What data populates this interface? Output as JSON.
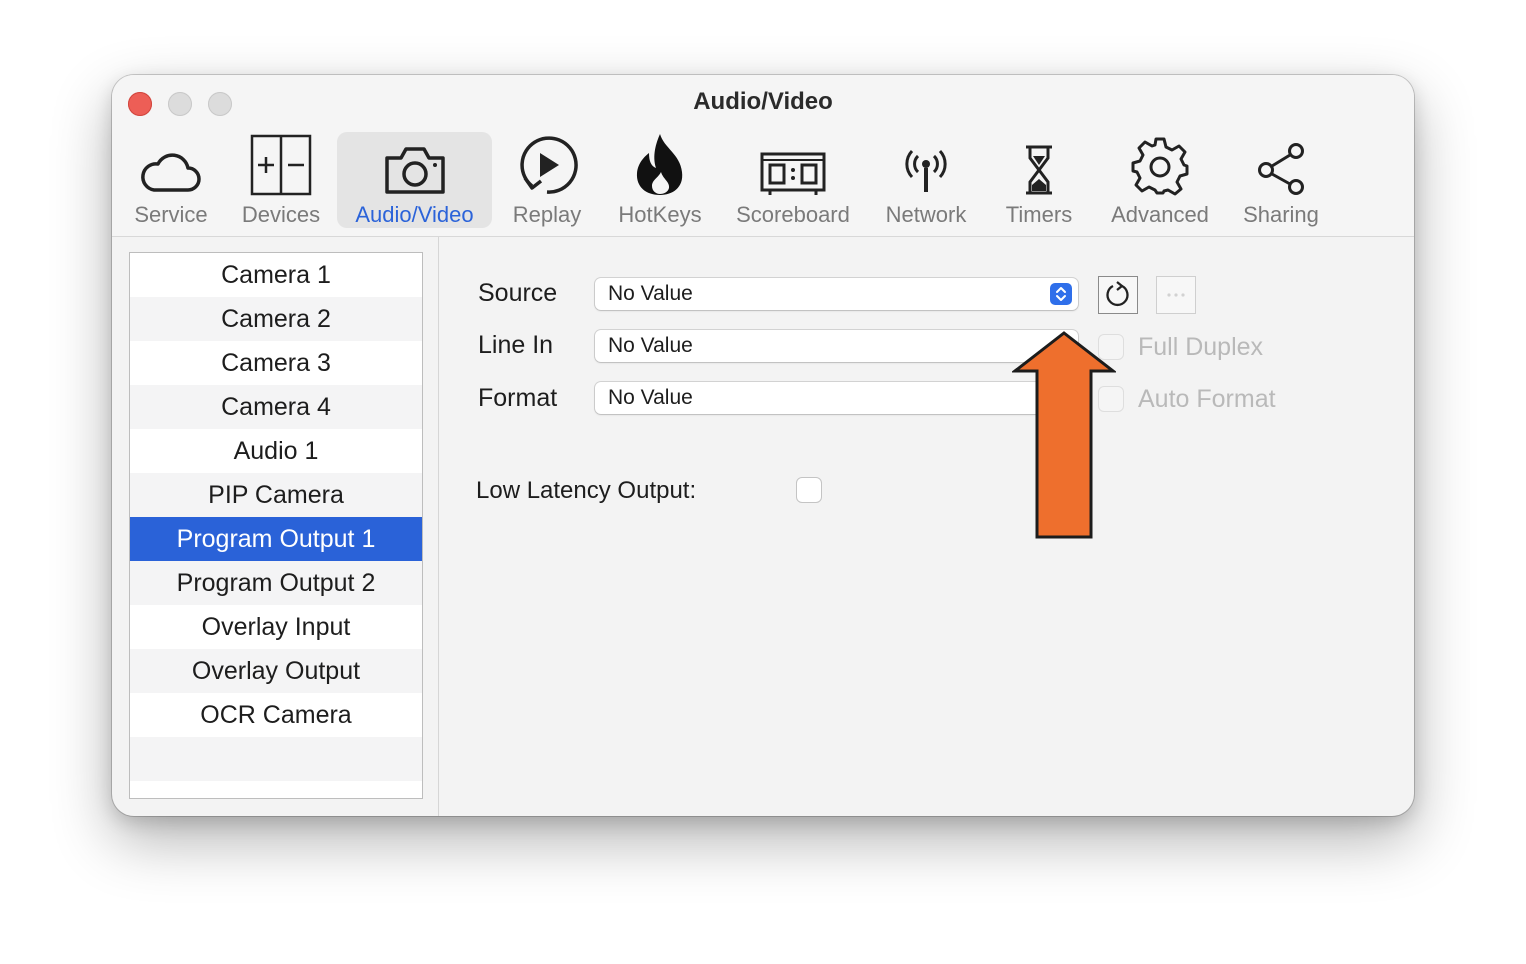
{
  "window": {
    "title": "Audio/Video"
  },
  "toolbar": {
    "items": [
      {
        "label": "Service",
        "icon": "cloud-icon"
      },
      {
        "label": "Devices",
        "icon": "devices-icon"
      },
      {
        "label": "Audio/Video",
        "icon": "camera-icon"
      },
      {
        "label": "Replay",
        "icon": "replay-icon"
      },
      {
        "label": "HotKeys",
        "icon": "flame-icon"
      },
      {
        "label": "Scoreboard",
        "icon": "scoreboard-icon"
      },
      {
        "label": "Network",
        "icon": "antenna-icon"
      },
      {
        "label": "Timers",
        "icon": "hourglass-icon"
      },
      {
        "label": "Advanced",
        "icon": "gear-icon"
      },
      {
        "label": "Sharing",
        "icon": "share-icon"
      }
    ],
    "active": "Audio/Video"
  },
  "sidebar": {
    "items": [
      "Camera 1",
      "Camera 2",
      "Camera 3",
      "Camera 4",
      "Audio 1",
      "PIP Camera",
      "Program Output 1",
      "Program Output 2",
      "Overlay Input",
      "Overlay Output",
      "OCR Camera"
    ],
    "selected": "Program Output 1"
  },
  "form": {
    "source": {
      "label": "Source",
      "value": "No Value"
    },
    "line_in": {
      "label": "Line In",
      "value": "No Value"
    },
    "format": {
      "label": "Format",
      "value": "No Value"
    },
    "full_duplex": {
      "label": "Full Duplex",
      "checked": false
    },
    "auto_format": {
      "label": "Auto Format",
      "checked": false
    },
    "low_latency": {
      "label": "Low Latency Output:",
      "checked": false
    },
    "refresh_icon": "refresh-icon",
    "more_icon": "ellipsis-icon"
  },
  "annotation": {
    "color": "#ee6f2d",
    "icon": "arrow-up-icon"
  },
  "colors": {
    "accent": "#2a62d8",
    "close": "#ed5e56"
  }
}
